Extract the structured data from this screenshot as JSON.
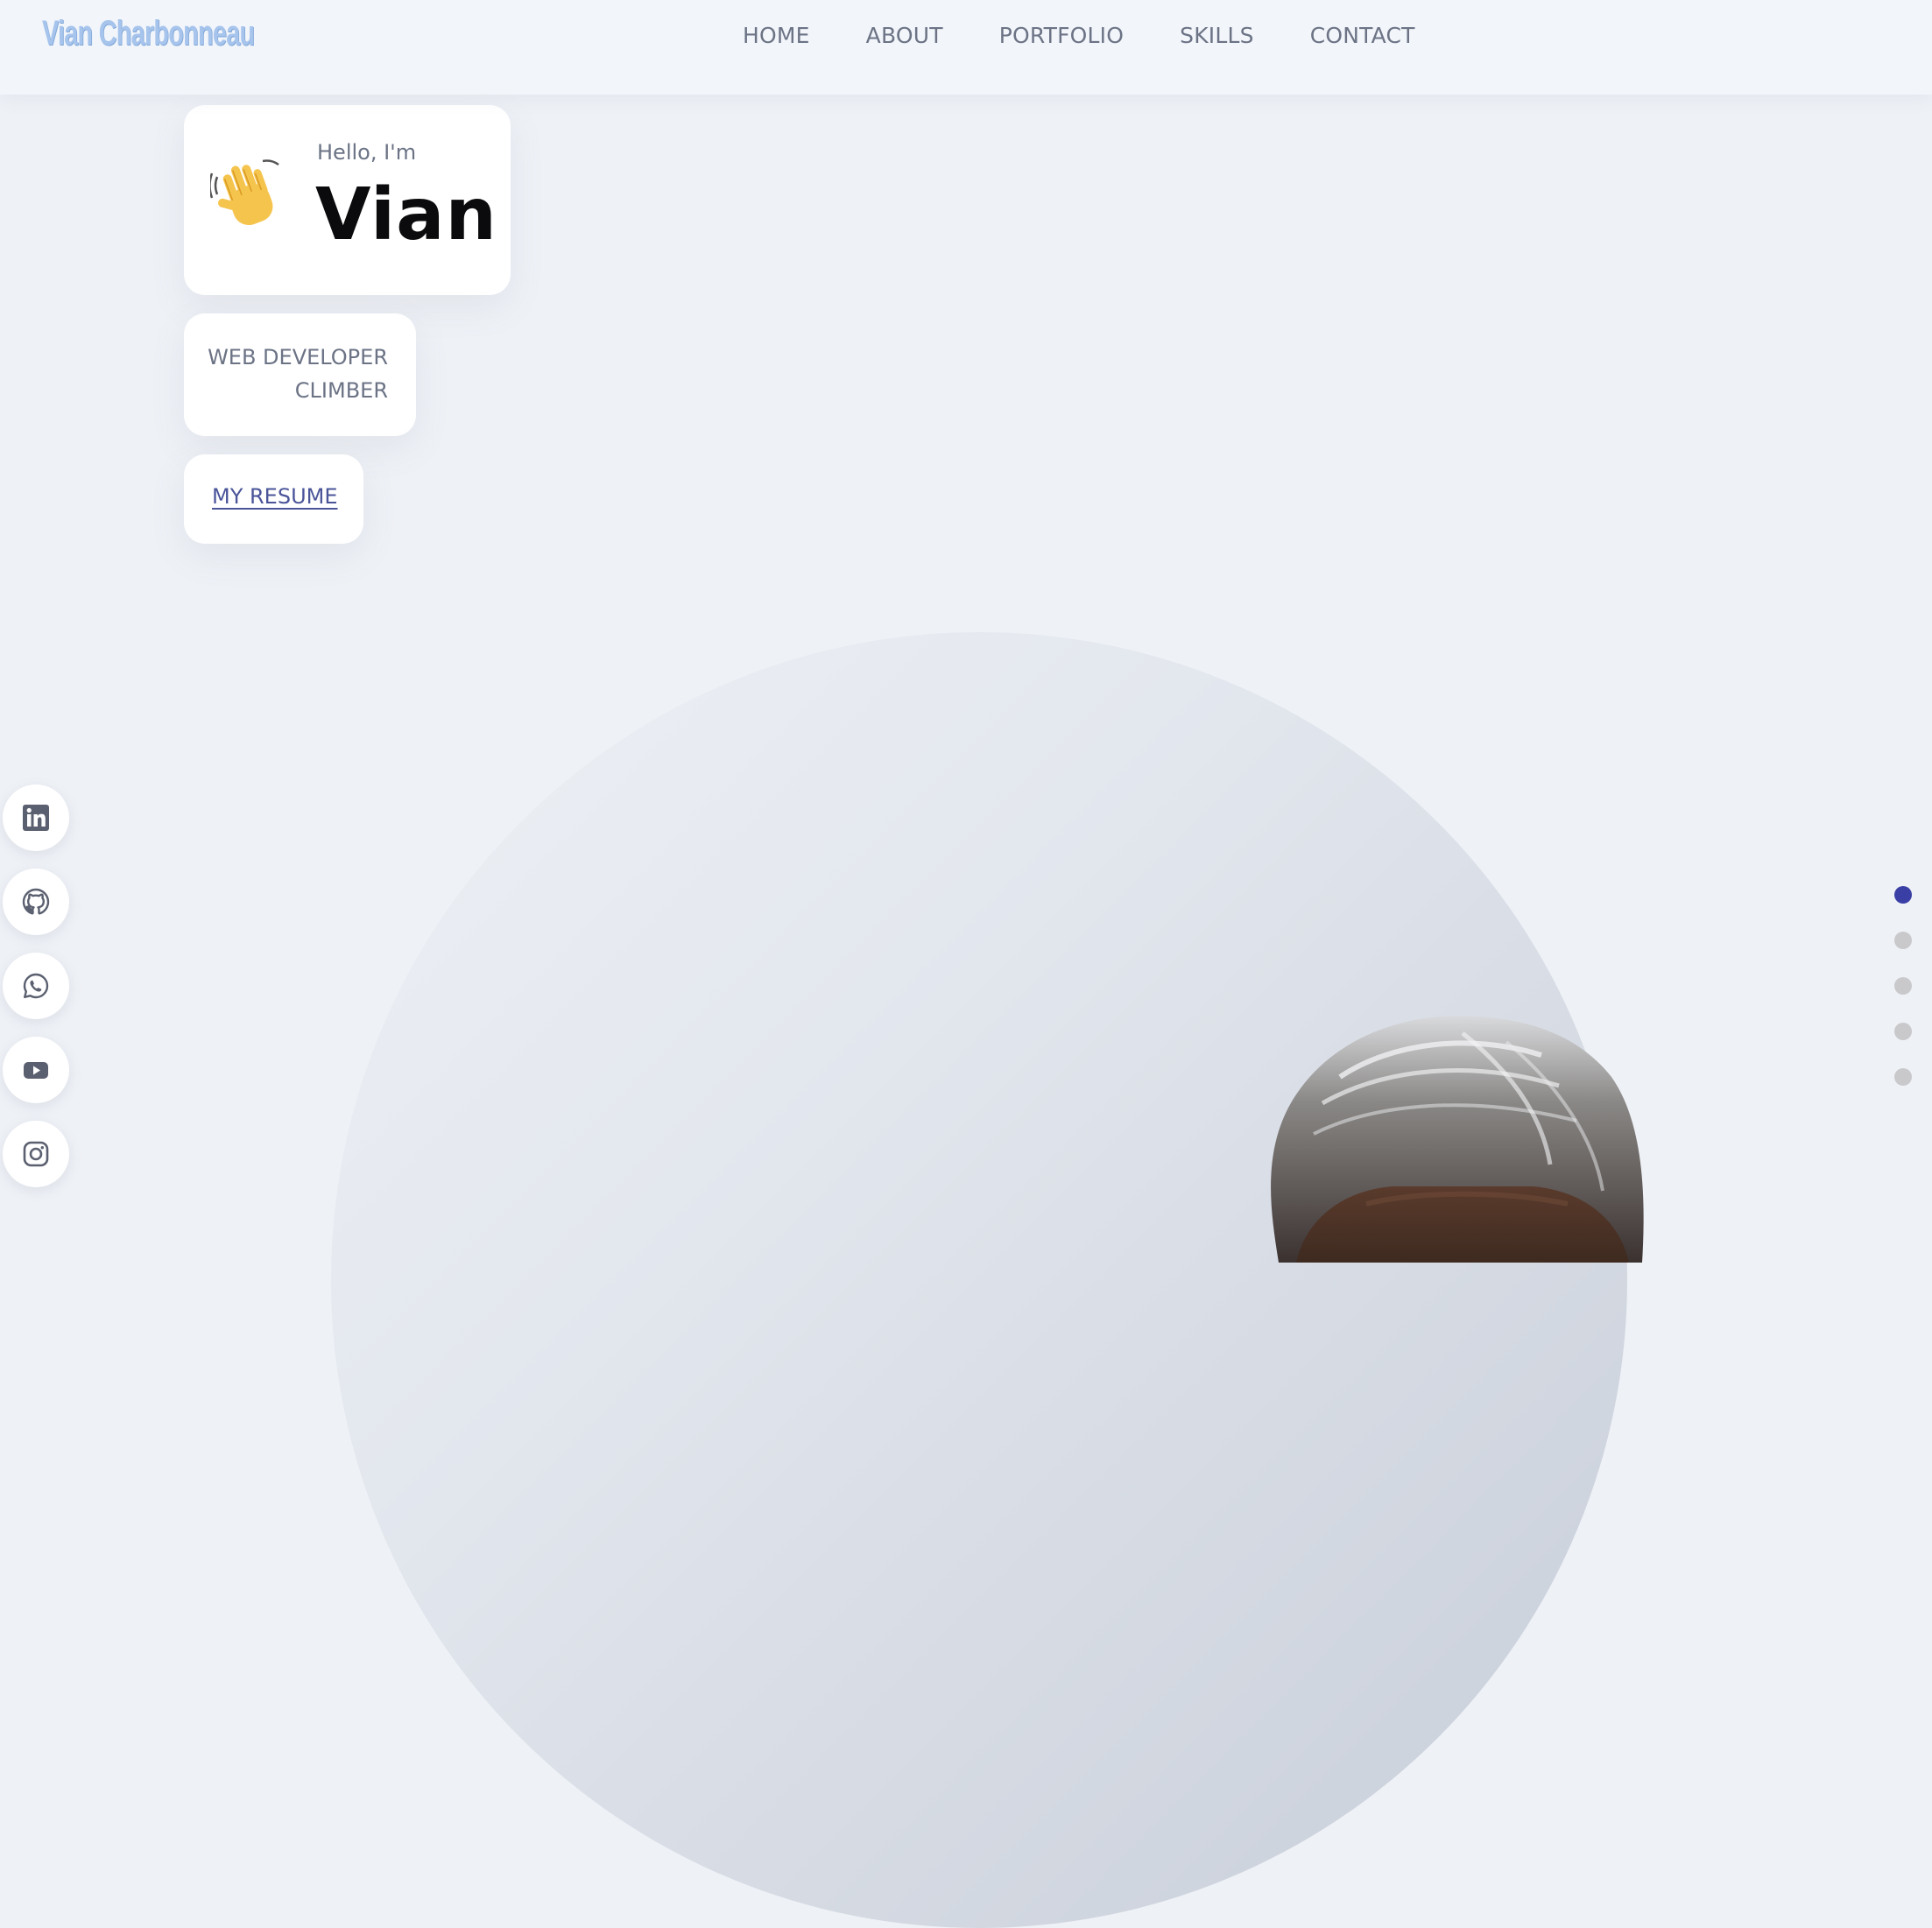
{
  "header": {
    "logo": "Vian Charbonneau",
    "nav": [
      {
        "label": "HOME"
      },
      {
        "label": "ABOUT"
      },
      {
        "label": "PORTFOLIO"
      },
      {
        "label": "SKILLS"
      },
      {
        "label": "CONTACT"
      }
    ]
  },
  "hero": {
    "greeting": "Hello, I'm",
    "name": "Vian",
    "wave_icon": "waving-hand-icon",
    "roles": [
      "WEB DEVELOPER",
      "CLIMBER"
    ],
    "resume_link": "MY RESUME"
  },
  "social": [
    {
      "icon": "linkedin-icon"
    },
    {
      "icon": "github-icon"
    },
    {
      "icon": "whatsapp-icon"
    },
    {
      "icon": "youtube-icon"
    },
    {
      "icon": "instagram-icon"
    }
  ],
  "section_dots": {
    "count": 5,
    "active_index": 0
  },
  "colors": {
    "background": "#eef1f6",
    "accent": "#3a3fa5",
    "nav_text": "#6b7385",
    "logo": "#a6c4ec"
  }
}
